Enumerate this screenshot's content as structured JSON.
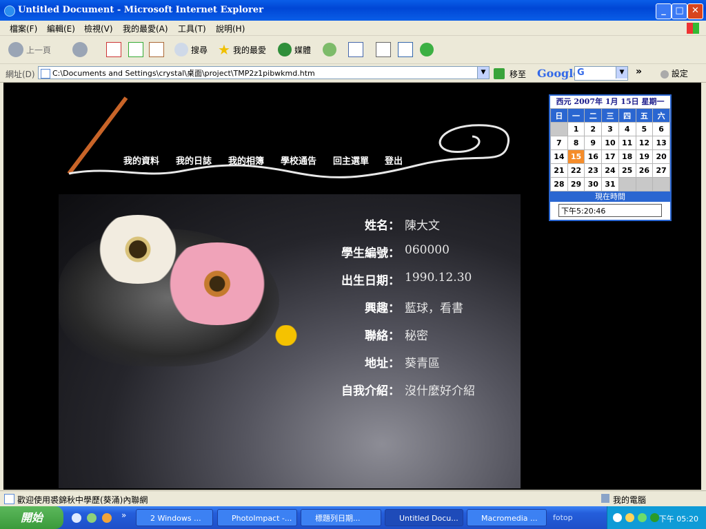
{
  "window": {
    "title": "Untitled Document - Microsoft Internet Explorer",
    "minimize": "_",
    "maximize": "□",
    "close": "✕"
  },
  "menu": [
    "檔案(F)",
    "編輯(E)",
    "檢視(V)",
    "我的最愛(A)",
    "工具(T)",
    "說明(H)"
  ],
  "toolbar": {
    "back": "上一頁",
    "search": "搜尋",
    "favorites": "我的最愛",
    "media": "媒體"
  },
  "address": {
    "label": "網址(D)",
    "url": "C:\\Documents and Settings\\crystal\\桌面\\project\\TMP2z1pibwkmd.htm",
    "go": "移至",
    "google": "Google",
    "google_box": "G",
    "more": "»",
    "settings": "設定"
  },
  "nav": [
    "我的資料",
    "我的日誌",
    "我的相簿",
    "學校通告",
    "回主選單",
    "登出"
  ],
  "profile": [
    {
      "key": "姓名：",
      "value": "陳大文"
    },
    {
      "key": "學生編號：",
      "value": "060000"
    },
    {
      "key": "出生日期：",
      "value": "1990.12.30"
    },
    {
      "key": "興趣：",
      "value": "藍球，看書"
    },
    {
      "key": "聯絡：",
      "value": "秘密"
    },
    {
      "key": "地址：",
      "value": "葵青區"
    },
    {
      "key": "自我介紹：",
      "value": "沒什麼好介紹"
    }
  ],
  "calendar": {
    "header": "西元 2007年 1月 15日 星期一",
    "dow": [
      "日",
      "一",
      "二",
      "三",
      "四",
      "五",
      "六"
    ],
    "weeks": [
      [
        "",
        "1",
        "2",
        "3",
        "4",
        "5",
        "6"
      ],
      [
        "7",
        "8",
        "9",
        "10",
        "11",
        "12",
        "13"
      ],
      [
        "14",
        "15",
        "16",
        "17",
        "18",
        "19",
        "20"
      ],
      [
        "21",
        "22",
        "23",
        "24",
        "25",
        "26",
        "27"
      ],
      [
        "28",
        "29",
        "30",
        "31",
        "",
        "",
        ""
      ]
    ],
    "today": "15",
    "time_label": "現在時間",
    "time_value": "下午5:20:46"
  },
  "status": {
    "message": "歡迎使用裘錦秋中學歷(葵涌)內聯網",
    "zone": "我的電腦"
  },
  "taskbar": {
    "start": "開始",
    "more": "»",
    "tasks": [
      "2 Windows ...",
      "PhotoImpact -...",
      "標題列日期...",
      "Untitled Docu...",
      "Macromedia ..."
    ],
    "tray_label": "fotop",
    "clock": "下午 05:20"
  },
  "colors": {
    "accent": "#2a66d1",
    "today": "#f58d2a",
    "content_bg": "#000000"
  }
}
